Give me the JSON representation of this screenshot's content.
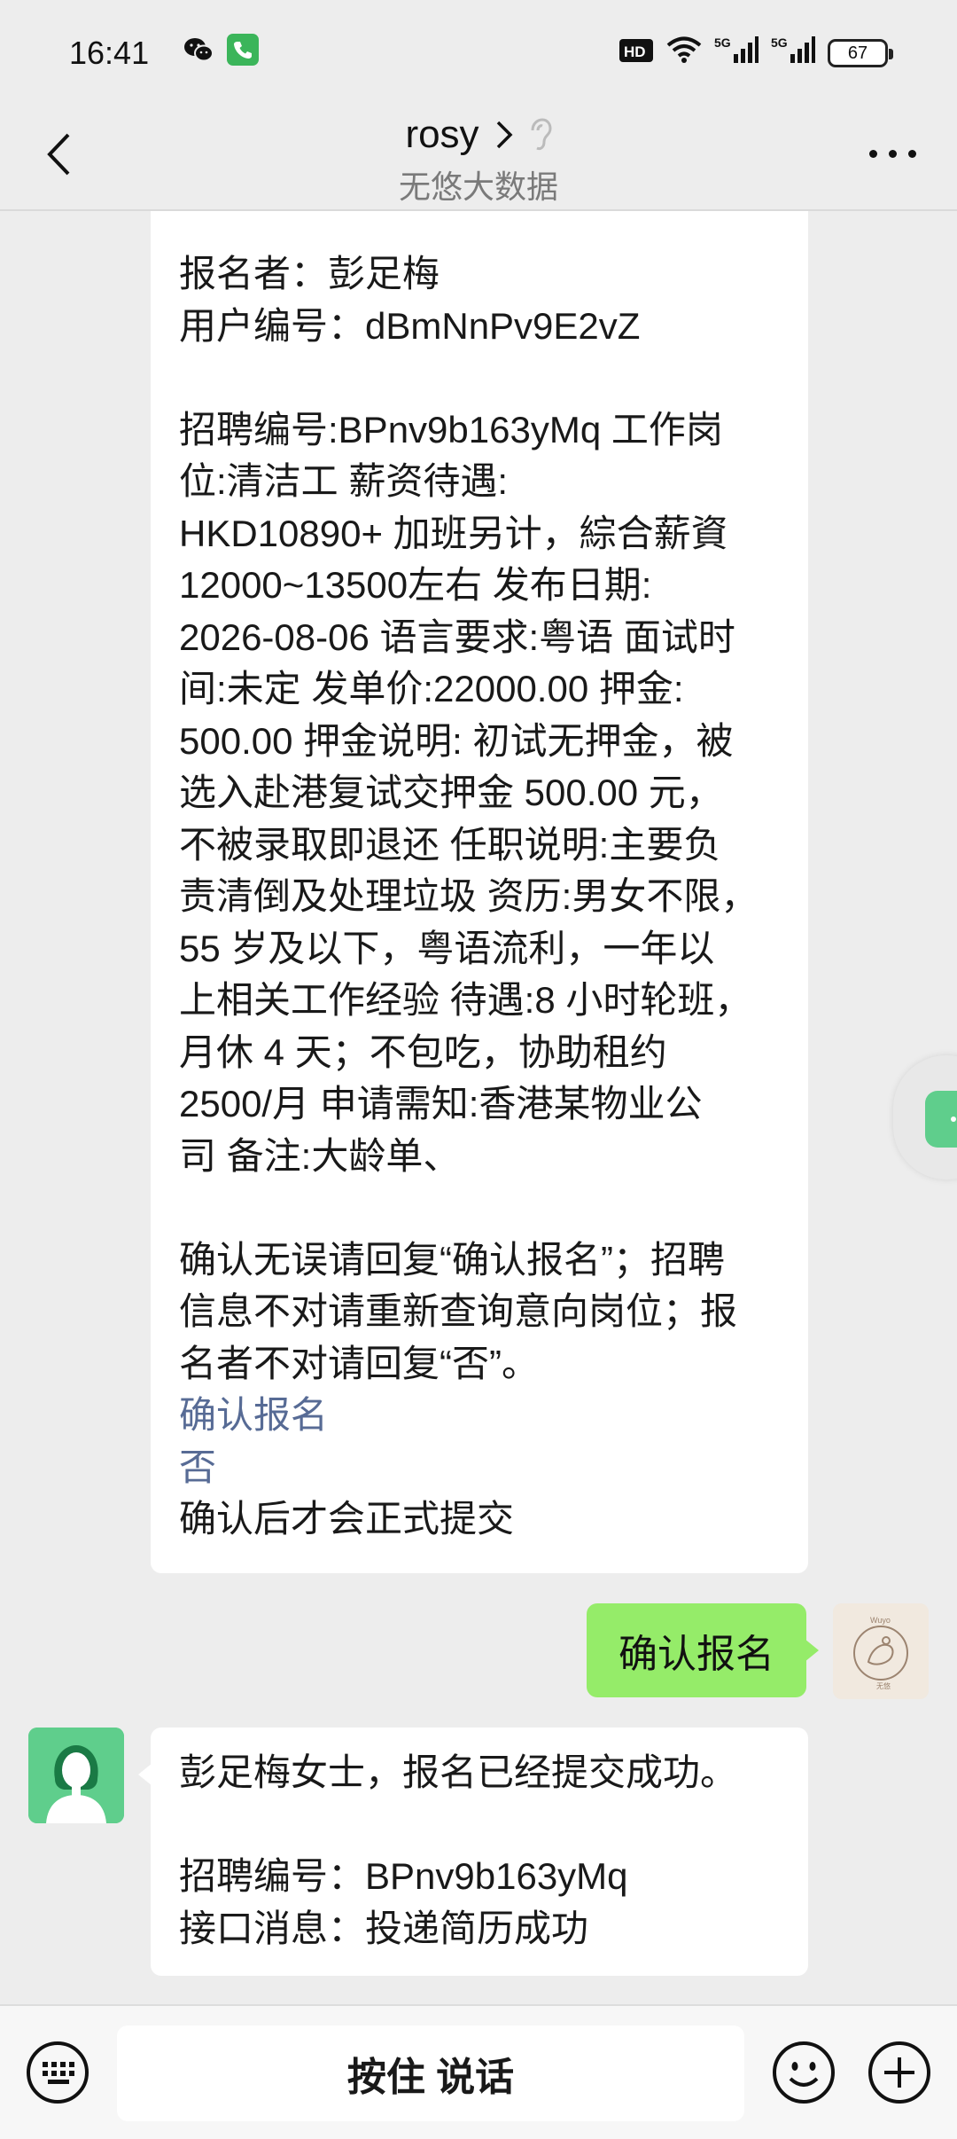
{
  "status_bar": {
    "time": "16:41",
    "battery": "67",
    "icons": [
      "wechat-icon",
      "phone-call-icon",
      "hd-icon",
      "wifi-icon",
      "5g-signal-icon",
      "5g-signal-icon"
    ]
  },
  "header": {
    "title": "rosy",
    "subtitle": "无悠大数据"
  },
  "messages": {
    "detail": {
      "lines_top": [
        "报名者：彭足梅",
        "用户编号：dBmNnPv9E2vZ"
      ],
      "job_info": [
        "招聘编号:BPnv9b163yMq 工作岗",
        "位:清洁工 薪资待遇:",
        "HKD10890+ 加班另计，綜合薪資",
        "12000~13500左右 发布日期:",
        "2026-08-06 语言要求:粤语 面试时",
        "间:未定 发单价:22000.00 押金:",
        "500.00 押金说明: 初试无押金，被",
        "选入赴港复试交押金 500.00 元，",
        "不被录取即退还 任职说明:主要负",
        "责清倒及处理垃圾 资历:男女不限，",
        "55 岁及以下，粤语流利，一年以",
        "上相关工作经验 待遇:8 小时轮班，",
        "月休 4 天；不包吃，协助租约",
        "2500/月 申请需知:香港某物业公",
        "司 备注:大龄单、"
      ],
      "confirm_text": [
        "确认无误请回复“确认报名”；招聘",
        "信息不对请重新查询意向岗位；报",
        "名者不对请回复“否”。"
      ],
      "link_confirm": "确认报名",
      "link_no": "否",
      "footer": "确认后才会正式提交"
    },
    "sent": "确认报名",
    "self_avatar_text": "Wuyo",
    "self_avatar_sub": "无悠",
    "reply": {
      "line1": "彭足梅女士，报名已经提交成功。",
      "line2": "招聘编号：BPnv9b163yMq",
      "line3": "接口消息：投递简历成功"
    }
  },
  "input_bar": {
    "talk_label": "按住 说话"
  }
}
